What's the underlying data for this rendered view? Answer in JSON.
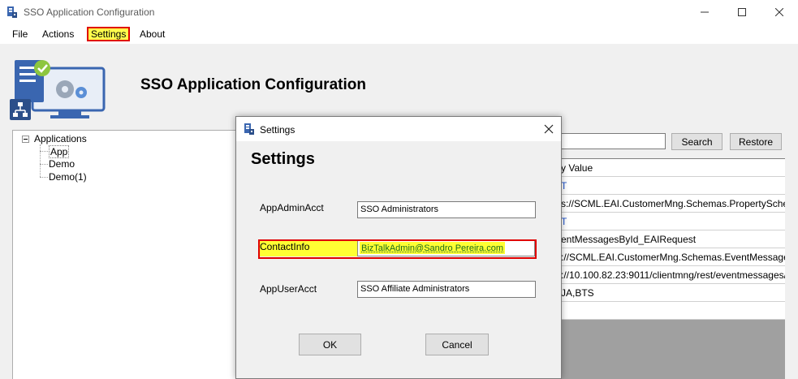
{
  "window": {
    "title": "SSO Application Configuration",
    "minimize": "–",
    "maximize": "☐",
    "close": "✕"
  },
  "menu": {
    "file": "File",
    "actions": "Actions",
    "settings": "Settings",
    "about": "About"
  },
  "header": {
    "title": "SSO Application Configuration"
  },
  "tree": {
    "root": "Applications",
    "items": [
      "App",
      "Demo",
      "Demo(1)"
    ]
  },
  "search": {
    "value": "",
    "search_label": "Search",
    "restore_label": "Restore"
  },
  "grid": {
    "rows": [
      "y Value",
      "T",
      "s://SCML.EAI.CustomerMng.Schemas.PropertySchema",
      "T",
      "entMessagesById_EAIRequest",
      "://SCML.EAI.CustomerMng.Schemas.EventMessages...",
      "://10.100.82.23:9011/clientmng/rest/eventmessages/...",
      "JA,BTS",
      ""
    ]
  },
  "dialog": {
    "title": "Settings",
    "heading": "Settings",
    "fields": {
      "admin_label": "AppAdminAcct",
      "admin_value": "SSO Administrators",
      "contact_label": "ContactInfo",
      "contact_value": "BizTalkAdmin@Sandro Pereira.com",
      "user_label": "AppUserAcct",
      "user_value": "SSO Affiliate Administrators"
    },
    "ok_label": "OK",
    "cancel_label": "Cancel"
  },
  "colors": {
    "highlight": "#ffff33",
    "annotation_border": "#e00000"
  }
}
